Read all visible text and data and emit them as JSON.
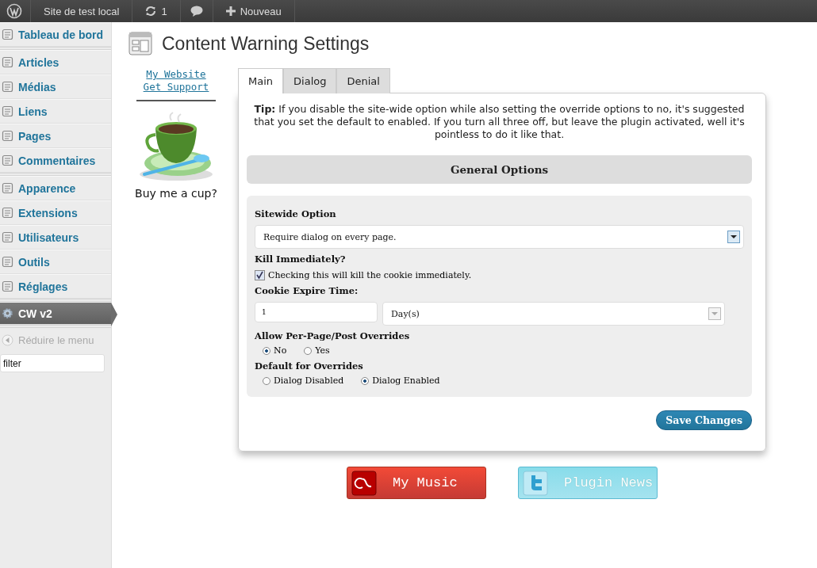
{
  "topbar": {
    "site": "Site de test local",
    "updates": "1",
    "new": "Nouveau"
  },
  "sidebar": {
    "groups": [
      [
        {
          "label": "Tableau de bord",
          "selected": false
        }
      ],
      [
        {
          "label": "Articles",
          "selected": false
        },
        {
          "label": "Médias",
          "selected": false
        },
        {
          "label": "Liens",
          "selected": false
        },
        {
          "label": "Pages",
          "selected": false
        },
        {
          "label": "Commentaires",
          "selected": false
        }
      ],
      [
        {
          "label": "Apparence",
          "selected": false
        },
        {
          "label": "Extensions",
          "selected": false
        },
        {
          "label": "Utilisateurs",
          "selected": false
        },
        {
          "label": "Outils",
          "selected": false
        },
        {
          "label": "Réglages",
          "selected": false
        }
      ],
      [
        {
          "label": "CW v2",
          "selected": true
        }
      ]
    ],
    "collapse": "Réduire le menu",
    "filter": {
      "value": "filter"
    }
  },
  "page": {
    "title": "Content Warning Settings"
  },
  "links": [
    "My Website",
    "Get Support"
  ],
  "donate": {
    "caption": "Buy me a cup?"
  },
  "tabs": [
    {
      "label": "Main",
      "selected": true
    },
    {
      "label": "Dialog",
      "selected": false
    },
    {
      "label": "Denial",
      "selected": false
    }
  ],
  "tip": "**Tip:** If you disable the site-wide option while also setting the override options to no, it's suggested that you set the default to enabled. If you turn all three off, but leave the plugin activated, well it's pointless to do it like that.",
  "section": "General Options",
  "fields": [
    {
      "kind": "select",
      "label": "Sitewide Option",
      "value": "Require dialog on every page."
    },
    {
      "kind": "checkbox",
      "label": "Kill Immediately?",
      "text": "Checking this will kill the cookie immediately.",
      "checked": true
    },
    {
      "kind": "duration",
      "label": "Cookie Expire Time:",
      "value": "1",
      "unit": "Day(s)"
    },
    {
      "kind": "radio",
      "label": "Allow Per-Page/Post Overrides",
      "options": [
        {
          "label": "No",
          "selected": true
        },
        {
          "label": "Yes",
          "selected": false
        }
      ]
    },
    {
      "kind": "radio",
      "label": "Default for Overrides",
      "options": [
        {
          "label": "Dialog Disabled",
          "selected": false
        },
        {
          "label": "Dialog Enabled",
          "selected": true
        }
      ]
    }
  ],
  "save": "Save Changes",
  "social": [
    {
      "kind": "music",
      "label": "My Music"
    },
    {
      "kind": "news",
      "label": "Plugin News"
    }
  ]
}
